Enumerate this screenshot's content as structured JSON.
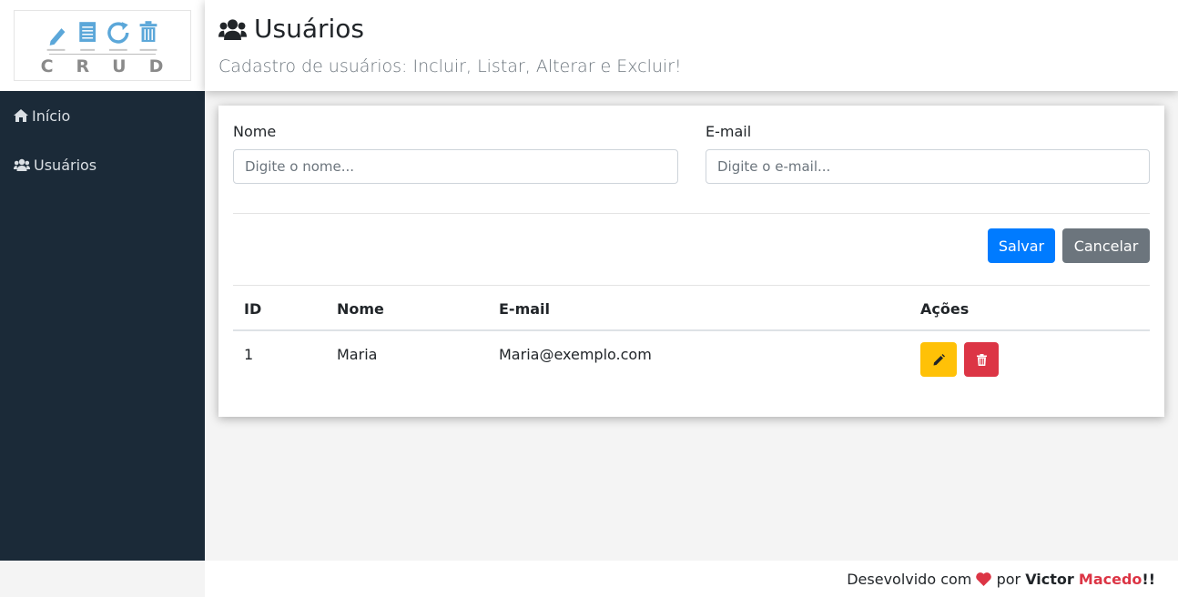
{
  "logo": {
    "letters": "CRUD"
  },
  "sidebar": {
    "items": [
      {
        "label": "Início",
        "icon": "home-icon"
      },
      {
        "label": "Usuários",
        "icon": "users-icon"
      }
    ]
  },
  "header": {
    "title": "Usuários",
    "icon": "users-icon",
    "subtitle": "Cadastro de usuários: Incluir, Listar, Alterar e Excluir!"
  },
  "form": {
    "name_label": "Nome",
    "name_placeholder": "Digite o nome...",
    "name_value": "",
    "email_label": "E-mail",
    "email_placeholder": "Digite o e-mail...",
    "email_value": "",
    "save_label": "Salvar",
    "cancel_label": "Cancelar"
  },
  "table": {
    "headers": [
      "ID",
      "Nome",
      "E-mail",
      "Ações"
    ],
    "rows": [
      {
        "id": "1",
        "name": "Maria",
        "email": "Maria@exemplo.com",
        "edit_icon": "pencil-icon",
        "delete_icon": "trash-icon"
      }
    ]
  },
  "footer": {
    "prefix": "Desevolvido com",
    "heart_icon": "heart-icon",
    "middle": "por",
    "first_name": "Victor",
    "last_name": "Macedo",
    "suffix": "!!"
  },
  "colors": {
    "sidebar_bg": "#1b2a38",
    "primary": "#007bff",
    "secondary": "#6c757d",
    "warning": "#ffc107",
    "danger": "#dc3545"
  }
}
